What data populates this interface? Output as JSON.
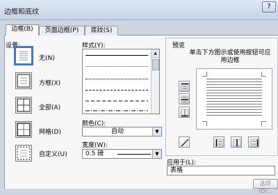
{
  "window": {
    "title": "边框和底纹",
    "help_label": "?"
  },
  "tabs": [
    {
      "label": "边框(B)",
      "active": true
    },
    {
      "label": "页面边框(P)",
      "active": false
    },
    {
      "label": "底纹(S)",
      "active": false
    }
  ],
  "settings": {
    "label": "设置:",
    "items": [
      {
        "label": "无(N)",
        "selected": true,
        "icon": "none-border-icon"
      },
      {
        "label": "方框(X)",
        "selected": false,
        "icon": "box-border-icon"
      },
      {
        "label": "全部(A)",
        "selected": false,
        "icon": "all-border-icon"
      },
      {
        "label": "网格(D)",
        "selected": false,
        "icon": "grid-border-icon"
      },
      {
        "label": "自定义(U)",
        "selected": false,
        "icon": "custom-border-icon"
      }
    ]
  },
  "style": {
    "label": "样式(Y):",
    "options": [
      "solid",
      "dotted-fine",
      "dotted",
      "dashed-short",
      "dashed",
      "dash-dot"
    ]
  },
  "color": {
    "label": "颜色(C):",
    "value": "自动"
  },
  "width": {
    "label": "宽度(W):",
    "value": "0.5 磅"
  },
  "preview": {
    "label": "预览",
    "instruction": "单击下方图示或使用按钮可应用边框"
  },
  "apply_to": {
    "label": "应用于(L):",
    "value": "表格"
  },
  "options_button": {
    "label": "选项(O)..."
  },
  "colors": {
    "titlebar": "#c4d3e6",
    "panel": "#f7f7f7",
    "selection": "#3b7bd8"
  }
}
